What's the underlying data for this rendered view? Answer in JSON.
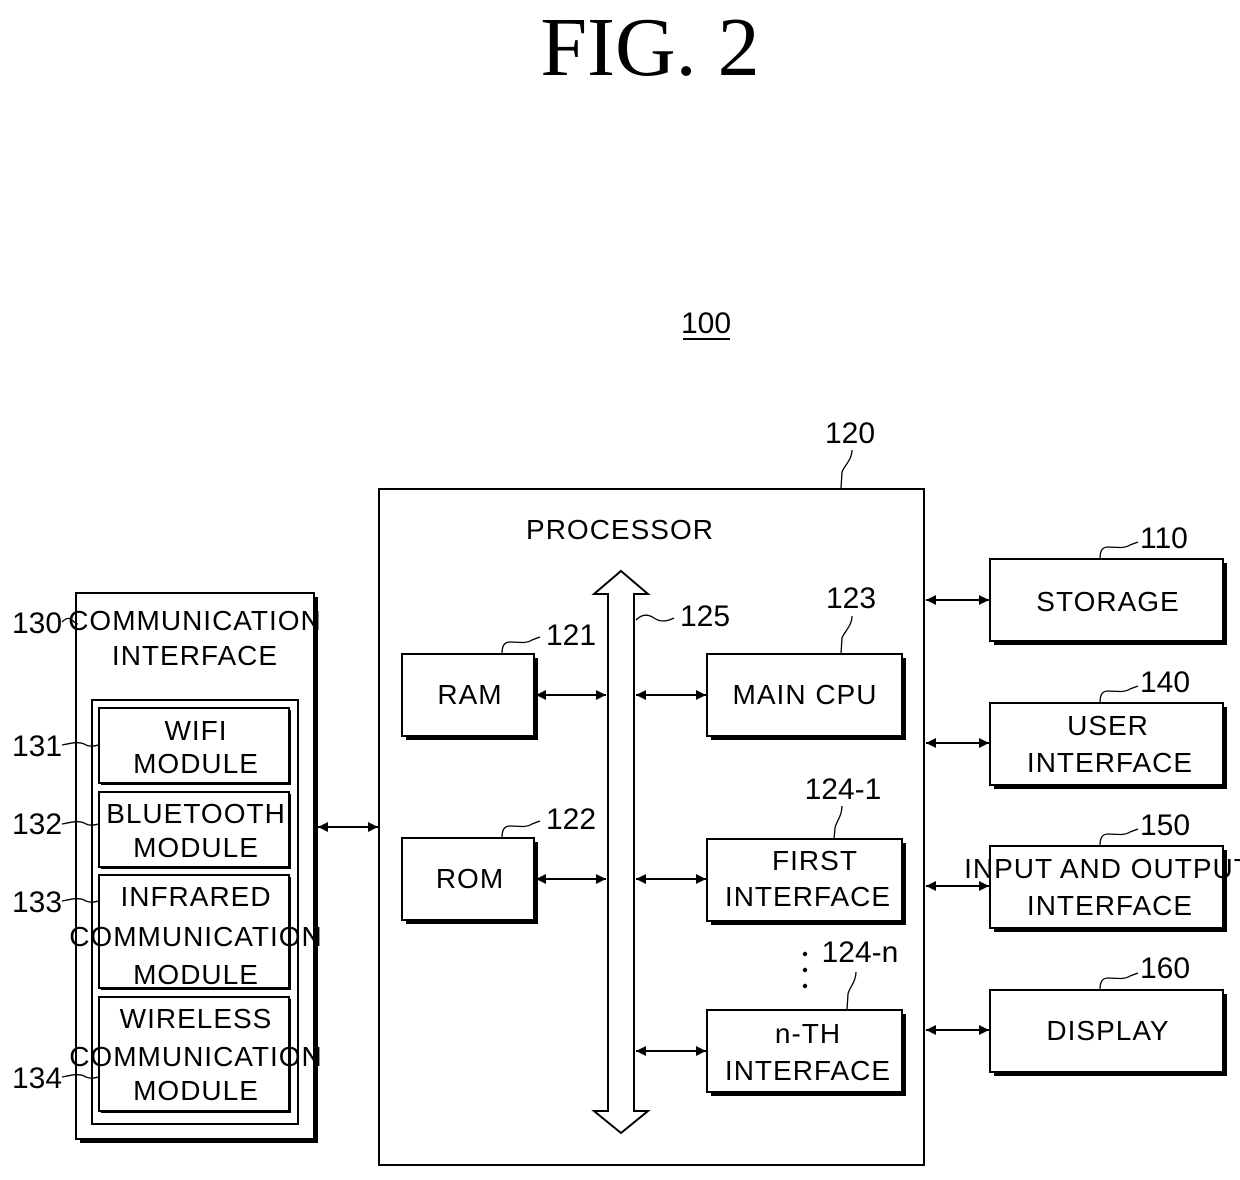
{
  "figure": {
    "title": "FIG. 2",
    "device_ref": "100"
  },
  "processor": {
    "ref": "120",
    "label": "PROCESSOR",
    "bus_ref": "125",
    "blocks": [
      {
        "ref": "121",
        "lines": [
          "RAM"
        ]
      },
      {
        "ref": "122",
        "lines": [
          "ROM"
        ]
      },
      {
        "ref": "123",
        "lines": [
          "MAIN CPU"
        ]
      },
      {
        "ref": "124-1",
        "lines": [
          "FIRST",
          "INTERFACE"
        ]
      },
      {
        "ref": "124-n",
        "lines": [
          "n-TH",
          "INTERFACE"
        ]
      }
    ],
    "ellipsis": "⋮"
  },
  "communication_interface": {
    "ref": "130",
    "lines": [
      "COMMUNICATION",
      "INTERFACE"
    ],
    "modules": [
      {
        "ref": "131",
        "lines": [
          "WIFI",
          "MODULE"
        ]
      },
      {
        "ref": "132",
        "lines": [
          "BLUETOOTH",
          "MODULE"
        ]
      },
      {
        "ref": "133",
        "lines": [
          "INFRARED",
          "COMMUNICATION",
          "MODULE"
        ]
      },
      {
        "ref": "134",
        "lines": [
          "WIRELESS",
          "COMMUNICATION",
          "MODULE"
        ]
      }
    ]
  },
  "peripherals": [
    {
      "ref": "110",
      "lines": [
        "STORAGE"
      ]
    },
    {
      "ref": "140",
      "lines": [
        "USER",
        "INTERFACE"
      ]
    },
    {
      "ref": "150",
      "lines": [
        "INPUT AND OUTPUT",
        "INTERFACE"
      ]
    },
    {
      "ref": "160",
      "lines": [
        "DISPLAY"
      ]
    }
  ]
}
